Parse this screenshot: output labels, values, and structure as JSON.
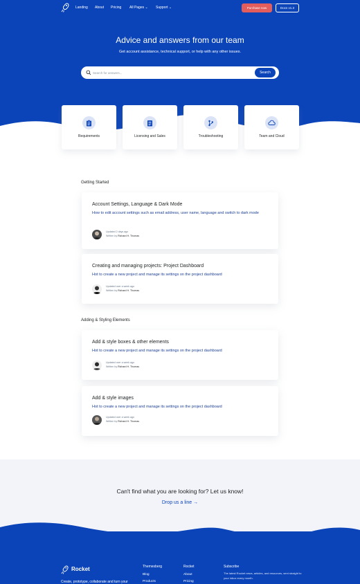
{
  "nav": {
    "links": [
      "Landing",
      "About",
      "Pricing",
      "All Pages",
      "Support"
    ],
    "purchase_label": "Purchase now",
    "docs_label": "Docs v1.3"
  },
  "hero": {
    "title": "Advice and answers from our team",
    "subtitle": "Get account assistance, technical support, or help with any other issues.",
    "search_placeholder": "Search for answers...",
    "search_button": "Search"
  },
  "categories": [
    {
      "label": "Requirements",
      "icon": "clipboard-icon"
    },
    {
      "label": "Licensing and Sales",
      "icon": "document-list-icon"
    },
    {
      "label": "Troubleshooting",
      "icon": "branch-icon"
    },
    {
      "label": "Team and Cloud",
      "icon": "cloud-icon"
    }
  ],
  "sections": [
    {
      "heading": "Getting Started",
      "articles": [
        {
          "title": "Account Settings, Language & Dark Mode",
          "description": "How to edit account settings such as email address, user name, language and switch to dark mode",
          "updated": "Updated 2 days ago",
          "written_prefix": "Written by",
          "author": "Richard H. Thomas"
        },
        {
          "title": "Creating and managing projects: Project Dashboard",
          "description": "Hot to create a new project and manage its settings on the project dashboard",
          "updated": "Updated over a week ago",
          "written_prefix": "Written by",
          "author": "Richard H. Thomas"
        }
      ]
    },
    {
      "heading": "Adding & Styling Elements",
      "articles": [
        {
          "title": "Add & style boxes & other elements",
          "description": "Hot to create a new project and manage its settings on the project dashboard",
          "updated": "Updated over a week ago",
          "written_prefix": "Written by",
          "author": "Richard H. Thomas"
        },
        {
          "title": "Add & style images",
          "description": "Hot to create a new project and manage its settings on the project dashboard",
          "updated": "Updated over a week ago",
          "written_prefix": "Written by",
          "author": "Richard H. Thomas"
        }
      ]
    }
  ],
  "cta": {
    "title": "Can't find what you are looking for? Let us know!",
    "link": "Drop us a line →"
  },
  "footer": {
    "brand": "Rocket",
    "tagline": "Create, prototype, collaborate and turn your",
    "col1_title": "Themesberg",
    "col1_links": [
      "Blog",
      "Products"
    ],
    "col2_title": "Rocket",
    "col2_links": [
      "About",
      "Pricing"
    ],
    "col3_title": "Subscribe",
    "col3_text": "The latest Rocket news, articles, and resources, sent straight to your inbox every month."
  },
  "colors": {
    "brand_blue": "#0b44b9",
    "purchase_red": "#e35d5d",
    "link_blue": "#1c3f94"
  }
}
